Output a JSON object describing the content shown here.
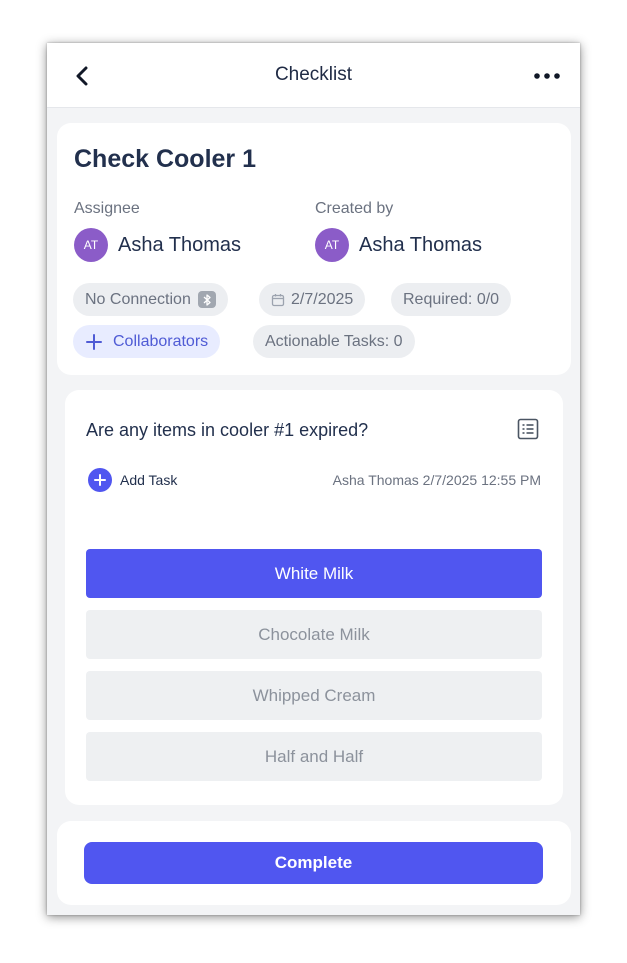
{
  "header": {
    "title": "Checklist",
    "back_icon": "chevron-left-icon",
    "more_icon": "more-horizontal-icon"
  },
  "checklist": {
    "title": "Check Cooler 1",
    "assignee_label": "Assignee",
    "assignee": {
      "initials": "AT",
      "name": "Asha Thomas"
    },
    "created_by_label": "Created by",
    "created_by": {
      "initials": "AT",
      "name": "Asha Thomas"
    },
    "chips": {
      "connection": "No Connection",
      "connection_icon": "bluetooth-icon",
      "date": "2/7/2025",
      "date_icon": "calendar-icon",
      "required": "Required: 0/0",
      "collaborators": "Collaborators",
      "actionable": "Actionable Tasks: 0"
    }
  },
  "question": {
    "text": "Are any items in cooler #1 expired?",
    "list_icon": "list-details-icon",
    "add_task_label": "Add Task",
    "stamp": "Asha Thomas 2/7/2025 12:55 PM",
    "options": [
      {
        "label": "White Milk",
        "selected": true
      },
      {
        "label": "Chocolate Milk",
        "selected": false
      },
      {
        "label": "Whipped Cream",
        "selected": false
      },
      {
        "label": "Half and Half",
        "selected": false
      }
    ]
  },
  "footer": {
    "complete_label": "Complete"
  },
  "colors": {
    "accent": "#5056f0",
    "avatar": "#8b5cc8",
    "chip_bg": "#eceef1",
    "collaborators_bg": "#e8ecff"
  }
}
